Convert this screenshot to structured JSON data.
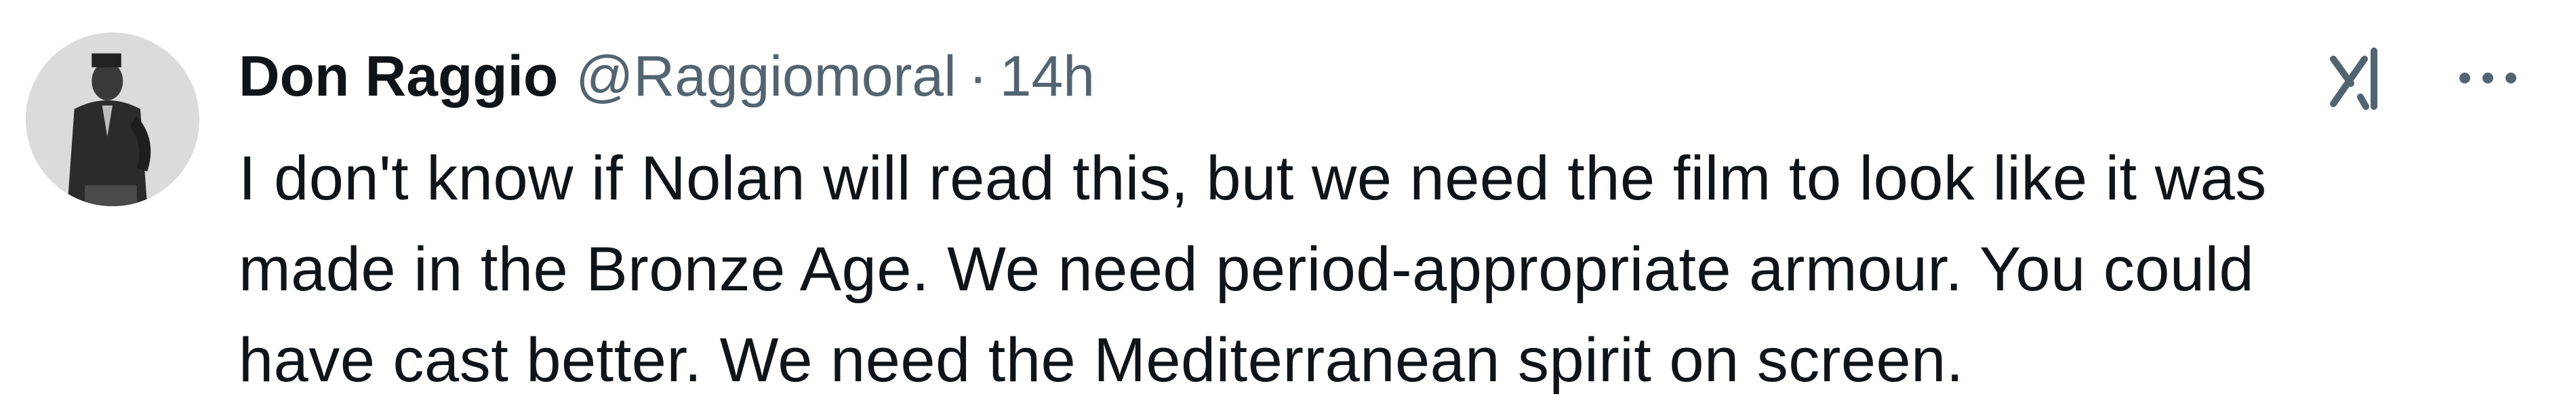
{
  "tweet": {
    "author": {
      "display_name": "Don Raggio",
      "handle": "@Raggiomoral",
      "avatar_icon": "avatar-photo-icon"
    },
    "separator": "·",
    "timestamp": "14h",
    "text": "I don't know if Nolan will read this, but we need the film to look like it was\nmade in the Bronze Age. We need period-appropriate armour. You could\nhave cast better. We need the Mediterranean spirit on screen.",
    "actions": {
      "grok_icon": "grok-icon",
      "more_icon": "more-options-icon"
    }
  },
  "colors": {
    "text_primary": "#0f1419",
    "text_secondary": "#536471",
    "background": "#ffffff"
  }
}
